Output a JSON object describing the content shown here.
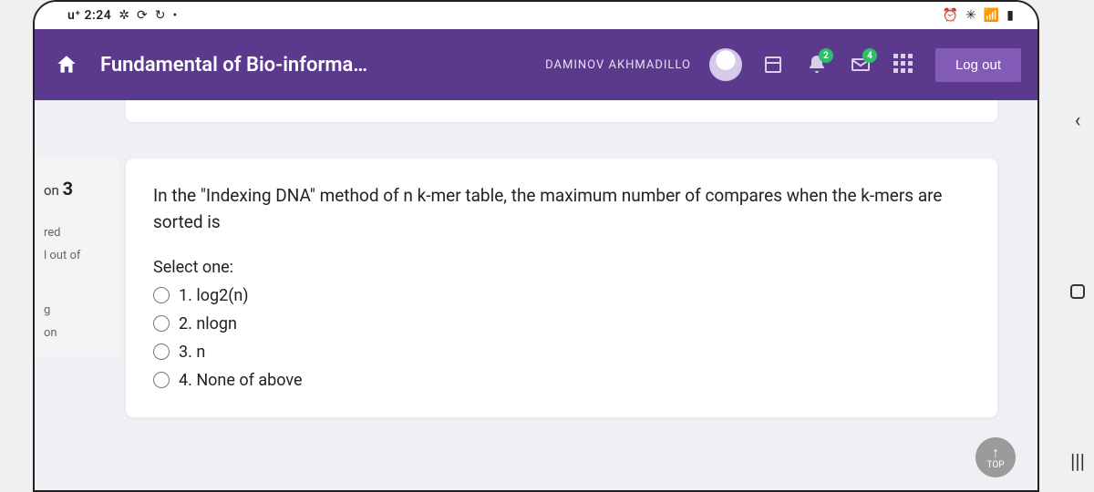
{
  "statusbar": {
    "time": "u⁺ 2:24",
    "left_icons": [
      "✲",
      "⟳",
      "↻",
      "•"
    ],
    "right_icons": [
      "⏰",
      "✳",
      "📶",
      "▮"
    ]
  },
  "header": {
    "course_title": "Fundamental of Bio-informa…",
    "user_name": "DAMINOV AKHMADILLO",
    "bell_badge": "2",
    "mail_badge": "4",
    "logout_label": "Log out"
  },
  "side": {
    "q_prefix": "on",
    "q_number": "3",
    "line2": "red",
    "line3": "l out of",
    "line4": "g",
    "line5": "on"
  },
  "question": {
    "text": "In the \"Indexing DNA\" method of n k-mer table, the maximum number of compares when the k-mers are sorted is",
    "select_label": "Select one:",
    "options": [
      "1. log2(n)",
      "2. nlogn",
      "3. n",
      "4. None of above"
    ]
  },
  "scrolltop": {
    "label": "TOP"
  }
}
